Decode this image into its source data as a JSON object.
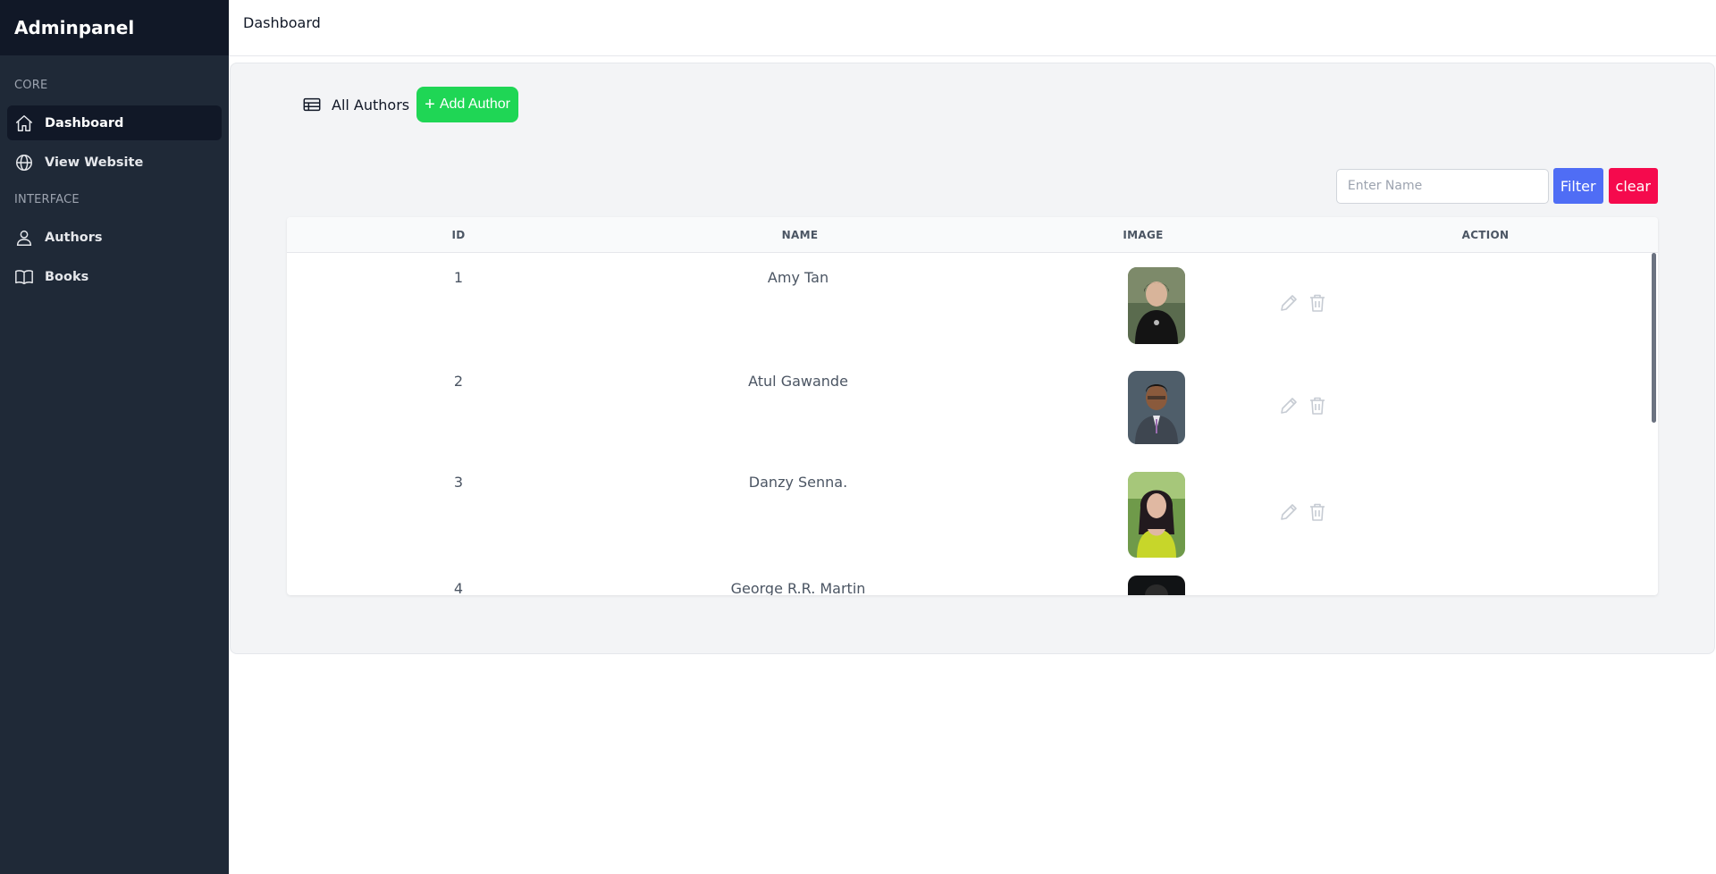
{
  "brand": "Adminpanel",
  "topbar": {
    "title": "Dashboard"
  },
  "sidebar": {
    "sections": [
      {
        "label": "CORE"
      },
      {
        "label": "INTERFACE"
      }
    ],
    "items": [
      {
        "label": "Dashboard",
        "icon": "home-icon",
        "active": true
      },
      {
        "label": "View Website",
        "icon": "globe-icon"
      },
      {
        "label": "Authors",
        "icon": "user-icon"
      },
      {
        "label": "Books",
        "icon": "book-icon"
      }
    ]
  },
  "main": {
    "title": "All Authors",
    "add_button": "Add Author",
    "filter": {
      "placeholder": "Enter Name",
      "value": "",
      "filter_label": "Filter",
      "clear_label": "clear"
    },
    "table": {
      "columns": [
        "ID",
        "NAME",
        "IMAGE",
        "ACTION"
      ],
      "rows": [
        {
          "id": "1",
          "name": "Amy Tan"
        },
        {
          "id": "2",
          "name": "Atul Gawande"
        },
        {
          "id": "3",
          "name": "Danzy Senna."
        },
        {
          "id": "4",
          "name": "George R.R. Martin"
        }
      ]
    }
  },
  "colors": {
    "sidebar_bg": "#1f2937",
    "brand_bg": "#111827",
    "add_button": "#1fd655",
    "filter_button": "#4f6df5",
    "clear_button": "#f50a4d"
  }
}
